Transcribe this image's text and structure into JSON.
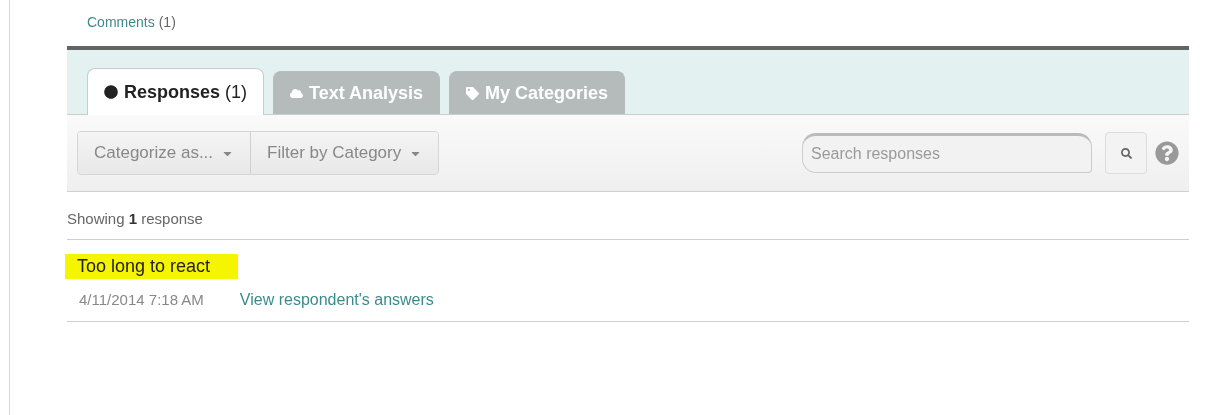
{
  "comments_link": {
    "label": "Comments",
    "count": "(1)"
  },
  "tabs": [
    {
      "label": "**Responses** (1)",
      "kind": "bubble",
      "selected": true
    },
    {
      "label": "Text Analysis",
      "kind": "cloud",
      "selected": false
    },
    {
      "label": "My Categories",
      "kind": "tag",
      "selected": false
    }
  ],
  "toolbar": {
    "dropdowns": [
      "Categorize as...",
      "Filter by Category"
    ],
    "search": {
      "placeholder": "Search responses"
    }
  },
  "summary": "Showing **1** response",
  "responses": [
    {
      "text": "Too long to react",
      "highlighted": true,
      "date": "4/11/2014 7:18 AM",
      "link": "View respondent's answers"
    }
  ]
}
